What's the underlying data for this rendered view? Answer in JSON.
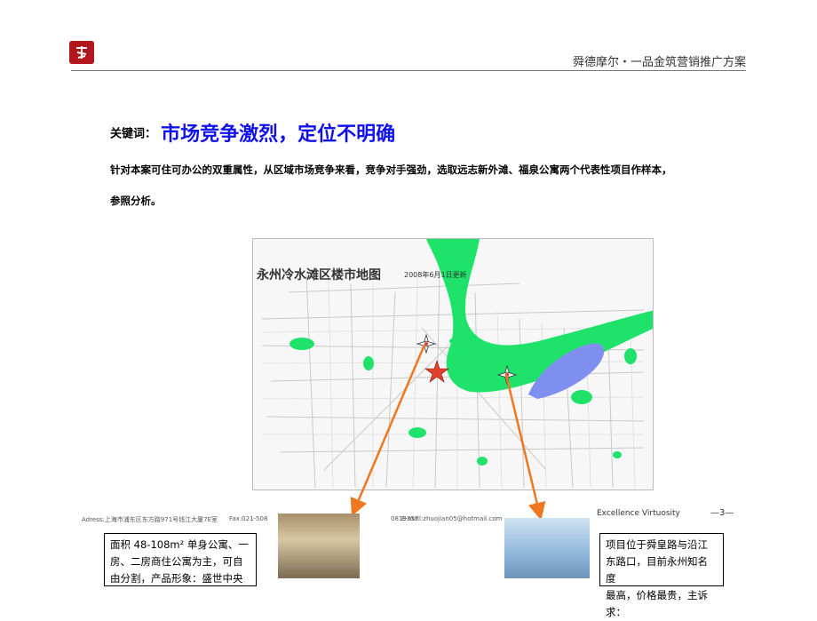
{
  "header": {
    "logo_icon": "calligraphy-seal-icon",
    "title": "舜德摩尔・一品金筑营销推广方案"
  },
  "keyword": {
    "label": "关键词：",
    "title": "市场竞争激烈，定位不明确"
  },
  "intro": {
    "line1": "针对本案可住可办公的双重属性，从区域市场竞争来看，竞争对手强劲，选取远志新外滩、福泉公寓两个代表性项目作样本，",
    "line2": "参照分析。"
  },
  "map": {
    "title": "永州冷水滩区楼市地图",
    "date": "2008年6月1日更新",
    "colors": {
      "river": "#1fe26a",
      "lake": "#7f8ff0",
      "arrow": "#ee7722",
      "star": "#e1402a"
    }
  },
  "footer": {
    "address": "Adress:上海市浦东区东方路971号钱江大厦7E室",
    "fax": "Fax:021-508",
    "phone": "0819337",
    "email": "E-mail:zhuojian05@hotmail.com",
    "brand": "Excellence Virtuosity",
    "page": "—3—"
  },
  "notes": {
    "left": [
      "面积 48-108m² 单身公寓、一",
      "房、二房商住公寓为主，可自",
      "由分割，产品形象：盛世中央"
    ],
    "right": [
      "项目位于舜皇路与沿江",
      "东路口，目前永州知名度",
      "最高，价格最贵，主诉求："
    ]
  }
}
